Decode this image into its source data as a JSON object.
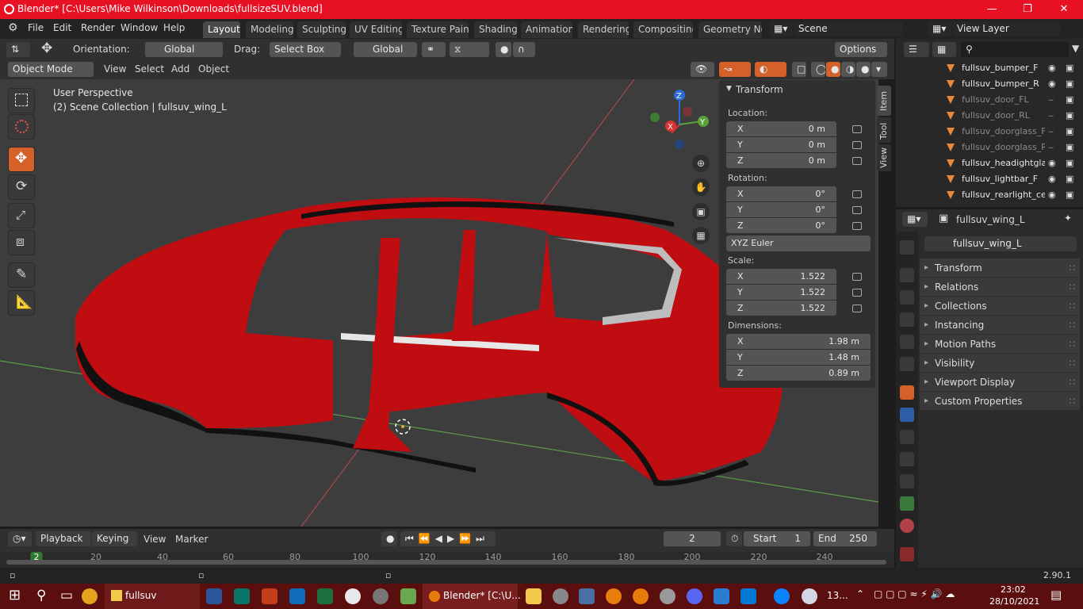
{
  "title": "Blender* [C:\\Users\\Mike Wilkinson\\Downloads\\fullsizeSUV.blend]",
  "menu": [
    "File",
    "Edit",
    "Render",
    "Window",
    "Help"
  ],
  "workspace_tabs": [
    "Layout",
    "Modeling",
    "Sculpting",
    "UV Editing",
    "Texture Paint",
    "Shading",
    "Animation",
    "Rendering",
    "Compositing",
    "Geometry Nod"
  ],
  "scene": "Scene",
  "view_layer": "View Layer",
  "tool_header": {
    "orientation_label": "Orientation:",
    "orientation_value": "Global",
    "drag_label": "Drag:",
    "drag_value": "Select Box",
    "transform_orientation": "Global",
    "options": "Options"
  },
  "viewport_header": {
    "mode": "Object Mode",
    "view": "View",
    "select": "Select",
    "add": "Add",
    "object": "Object"
  },
  "viewport": {
    "perspective": "User Perspective",
    "collection": "(2) Scene Collection | fullsuv_wing_L",
    "gizmo_x": "X",
    "gizmo_y": "Y",
    "gizmo_z": "Z"
  },
  "npanel": {
    "header": "Transform",
    "location_label": "Location:",
    "location": [
      "0 m",
      "0 m",
      "0 m"
    ],
    "rotation_label": "Rotation:",
    "rotation": [
      "0°",
      "0°",
      "0°"
    ],
    "rotation_mode": "XYZ Euler",
    "scale_label": "Scale:",
    "scale": [
      "1.522",
      "1.522",
      "1.522"
    ],
    "dimensions_label": "Dimensions:",
    "dimensions": [
      "1.98 m",
      "1.48 m",
      "0.89 m"
    ],
    "axes": [
      "X",
      "Y",
      "Z"
    ],
    "side_tabs": [
      "Item",
      "Tool",
      "View"
    ]
  },
  "outliner": [
    {
      "name": "fullsuv_bumper_F",
      "dim": false
    },
    {
      "name": "fullsuv_bumper_R",
      "dim": false
    },
    {
      "name": "fullsuv_door_FL",
      "dim": true
    },
    {
      "name": "fullsuv_door_RL",
      "dim": true
    },
    {
      "name": "fullsuv_doorglass_FL",
      "dim": true
    },
    {
      "name": "fullsuv_doorglass_RL",
      "dim": true
    },
    {
      "name": "fullsuv_headightglass",
      "dim": false
    },
    {
      "name": "fullsuv_lightbar_F",
      "dim": false
    },
    {
      "name": "fullsuv_rearlight_cent",
      "dim": false
    }
  ],
  "properties": {
    "context": "fullsuv_wing_L",
    "object_name": "fullsuv_wing_L",
    "sections": [
      "Transform",
      "Relations",
      "Collections",
      "Instancing",
      "Motion Paths",
      "Visibility",
      "Viewport Display",
      "Custom Properties"
    ]
  },
  "timeline": {
    "playback": "Playback",
    "keying": "Keying",
    "view": "View",
    "marker": "Marker",
    "current_frame": "2",
    "start_label": "Start",
    "start": "1",
    "end_label": "End",
    "end": "250",
    "ruler": [
      "2",
      "20",
      "40",
      "60",
      "80",
      "100",
      "120",
      "140",
      "160",
      "180",
      "200",
      "220",
      "240"
    ]
  },
  "status": {
    "version": "2.90.1"
  },
  "taskbar": {
    "folder": "fullsuv",
    "blender": "Blender* [C:\\U...",
    "weather": "13...",
    "time": "23:02",
    "date": "28/10/2021"
  },
  "colors": {
    "accent": "#d4602a",
    "title_bar": "#e81123",
    "car": "#c00d12",
    "taskbar": "#5b0e0e"
  }
}
